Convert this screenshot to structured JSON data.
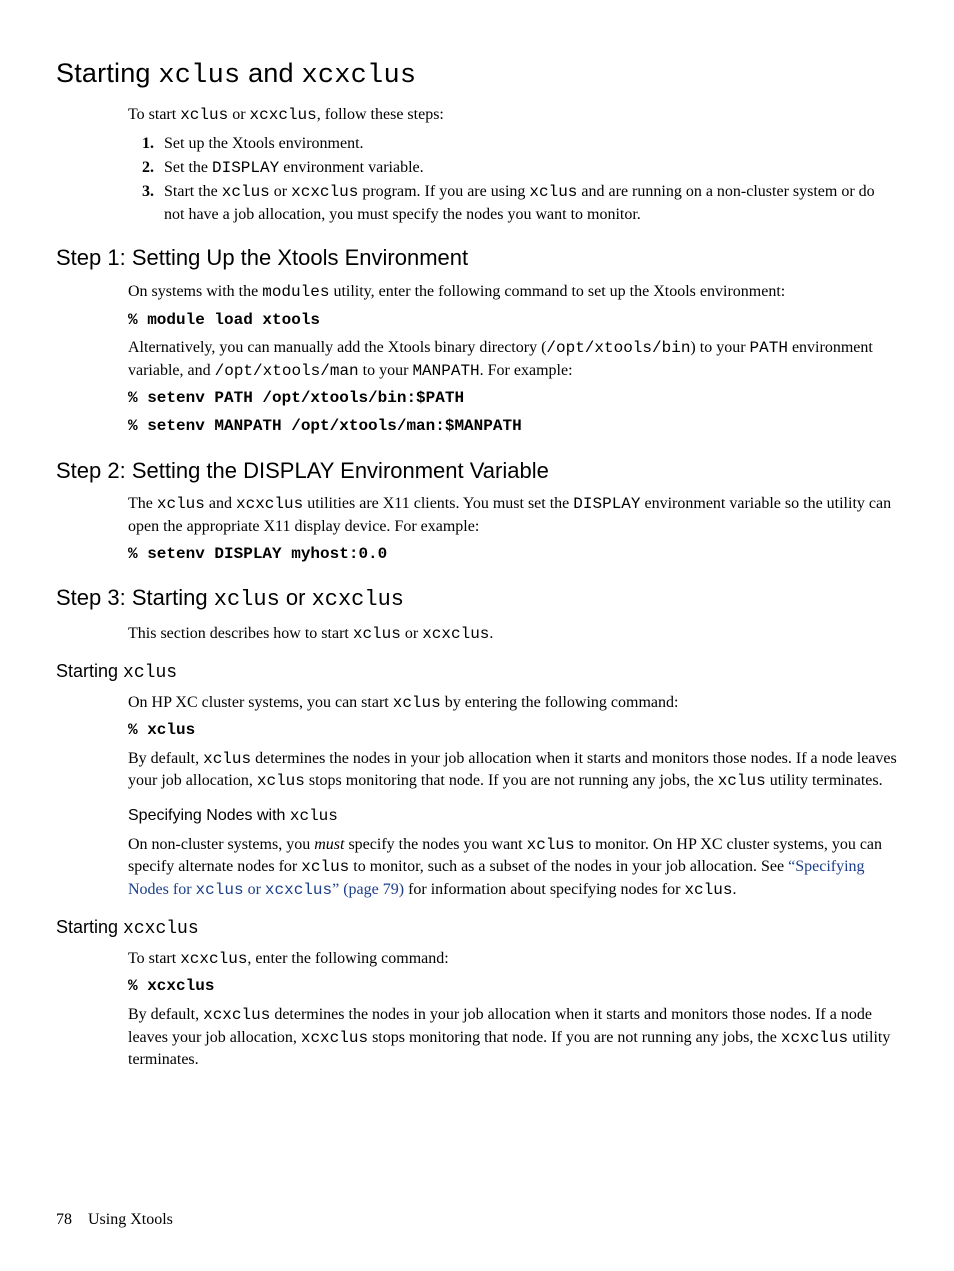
{
  "h1_pre": "Starting ",
  "h1_code1": "xclus",
  "h1_mid": " and ",
  "h1_code2": "xcxclus",
  "intro_pre": "To start ",
  "intro_c1": "xclus",
  "intro_mid": " or ",
  "intro_c2": "xcxclus",
  "intro_post": ", follow these steps:",
  "step1_li": "Set up the Xtools environment.",
  "step2_li_pre": "Set the ",
  "step2_li_code": "DISPLAY",
  "step2_li_post": " environment variable.",
  "step3_li_pre": "Start the ",
  "step3_li_c1": "xclus",
  "step3_li_mid1": " or ",
  "step3_li_c2": "xcxclus",
  "step3_li_mid2": " program. If you are using ",
  "step3_li_c3": "xclus",
  "step3_li_post": " and are running on a non-cluster system or do not have a job allocation, you must specify the nodes you want to monitor.",
  "h2_step1": "Step 1: Setting Up the Xtools Environment",
  "s1_p1_pre": "On systems with the ",
  "s1_p1_code": "modules",
  "s1_p1_post": " utility, enter the following command to set up the Xtools environment:",
  "s1_cmd1": "% module load xtools",
  "s1_p2_pre": "Alternatively, you can manually add the Xtools binary directory (",
  "s1_p2_code1": "/opt/xtools/bin",
  "s1_p2_mid1": ") to your ",
  "s1_p2_code2": "PATH",
  "s1_p2_mid2": " environment variable, and ",
  "s1_p2_code3": "/opt/xtools/man",
  "s1_p2_mid3": " to your ",
  "s1_p2_code4": "MANPATH",
  "s1_p2_post": ". For example:",
  "s1_cmd2": "% setenv PATH /opt/xtools/bin:$PATH",
  "s1_cmd3": "% setenv MANPATH /opt/xtools/man:$MANPATH",
  "h2_step2": "Step 2: Setting the DISPLAY Environment Variable",
  "s2_p1_pre": "The ",
  "s2_p1_c1": "xclus",
  "s2_p1_mid1": " and ",
  "s2_p1_c2": "xcxclus",
  "s2_p1_mid2": " utilities are X11 clients. You must set the ",
  "s2_p1_c3": "DISPLAY",
  "s2_p1_post": " environment variable so the utility can open the appropriate X11 display device. For example:",
  "s2_cmd1": "% setenv DISPLAY myhost:0.0",
  "h2_step3_pre": "Step 3: Starting ",
  "h2_step3_c1": "xclus",
  "h2_step3_mid": " or ",
  "h2_step3_c2": "xcxclus",
  "s3_p1_pre": "This section describes how to start ",
  "s3_p1_c1": "xclus",
  "s3_p1_mid": " or ",
  "s3_p1_c2": "xcxclus",
  "s3_p1_post": ".",
  "h3_sx_pre": "Starting ",
  "h3_sx_code": "xclus",
  "sx_p1_pre": "On HP XC cluster systems, you can start ",
  "sx_p1_code": "xclus",
  "sx_p1_post": " by entering the following command:",
  "sx_cmd1": "% xclus",
  "sx_p2_pre": "By default, ",
  "sx_p2_c1": "xclus",
  "sx_p2_mid1": " determines the nodes in your job allocation when it starts and monitors those nodes. If a node leaves your job allocation, ",
  "sx_p2_c2": "xclus",
  "sx_p2_mid2": " stops monitoring that node. If you are not running any jobs, the ",
  "sx_p2_c3": "xclus",
  "sx_p2_post": " utility terminates.",
  "h4_spec_pre": "Specifying Nodes with ",
  "h4_spec_code": "xclus",
  "sp_p1_pre": "On non-cluster systems, you ",
  "sp_p1_em": "must",
  "sp_p1_mid1": " specify the nodes you want ",
  "sp_p1_c1": "xclus",
  "sp_p1_mid2": " to monitor. On HP XC cluster systems, you can specify alternate nodes for ",
  "sp_p1_c2": "xclus",
  "sp_p1_mid3": " to monitor, such as a subset of the nodes in your job allocation. See ",
  "sp_link_pre": "“Specifying Nodes for ",
  "sp_link_c1": "xclus",
  "sp_link_mid": " or ",
  "sp_link_c2": "xcxclus",
  "sp_link_post": "” (page 79)",
  "sp_p1_mid4": " for information about specifying nodes for ",
  "sp_p1_c3": "xclus",
  "sp_p1_post": ".",
  "h3_sxc_pre": "Starting ",
  "h3_sxc_code": "xcxclus",
  "sxc_p1_pre": "To start ",
  "sxc_p1_code": "xcxclus",
  "sxc_p1_post": ", enter the following command:",
  "sxc_cmd1": "% xcxclus",
  "sxc_p2_pre": "By default, ",
  "sxc_p2_c1": "xcxclus",
  "sxc_p2_mid1": " determines the nodes in your job allocation when it starts and monitors those nodes. If a node leaves your job allocation, ",
  "sxc_p2_c2": "xcxclus",
  "sxc_p2_mid2": " stops monitoring that node. If you are not running any jobs, the ",
  "sxc_p2_c3": "xcxclus",
  "sxc_p2_post": " utility terminates.",
  "footer_page": "78",
  "footer_title": "Using Xtools"
}
